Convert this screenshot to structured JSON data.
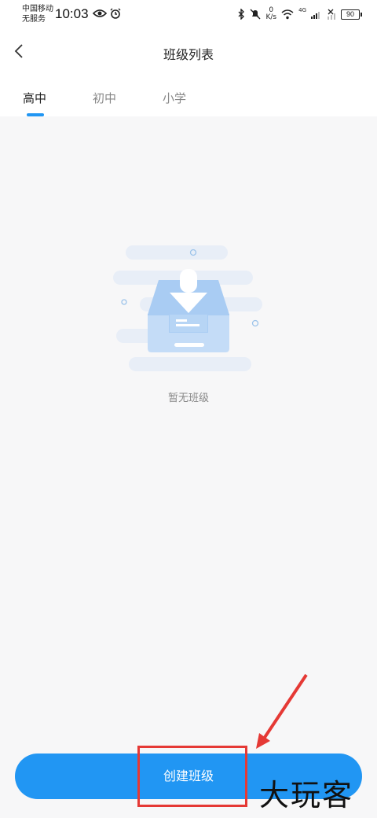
{
  "status_bar": {
    "carrier_line1": "中国移动",
    "carrier_line2": "无服务",
    "time": "10:03",
    "net_speed_value": "0",
    "net_speed_unit": "K/s",
    "signal_label": "4G",
    "battery": "90",
    "icons": [
      "eye-icon",
      "alarm-icon",
      "bluetooth-icon",
      "mute-icon",
      "wifi-icon",
      "signal-icon"
    ]
  },
  "header": {
    "title": "班级列表",
    "back_icon": "chevron-left-icon"
  },
  "tabs": [
    {
      "label": "高中",
      "active": true
    },
    {
      "label": "初中",
      "active": false
    },
    {
      "label": "小学",
      "active": false
    }
  ],
  "empty_state": {
    "icon": "empty-inbox-icon",
    "text": "暂无班级"
  },
  "footer": {
    "create_button_label": "创建班级"
  },
  "overlay": {
    "watermark": "大玩客",
    "highlight_color": "#e53935"
  },
  "colors": {
    "accent": "#2196f3",
    "background": "#f7f7f8"
  }
}
